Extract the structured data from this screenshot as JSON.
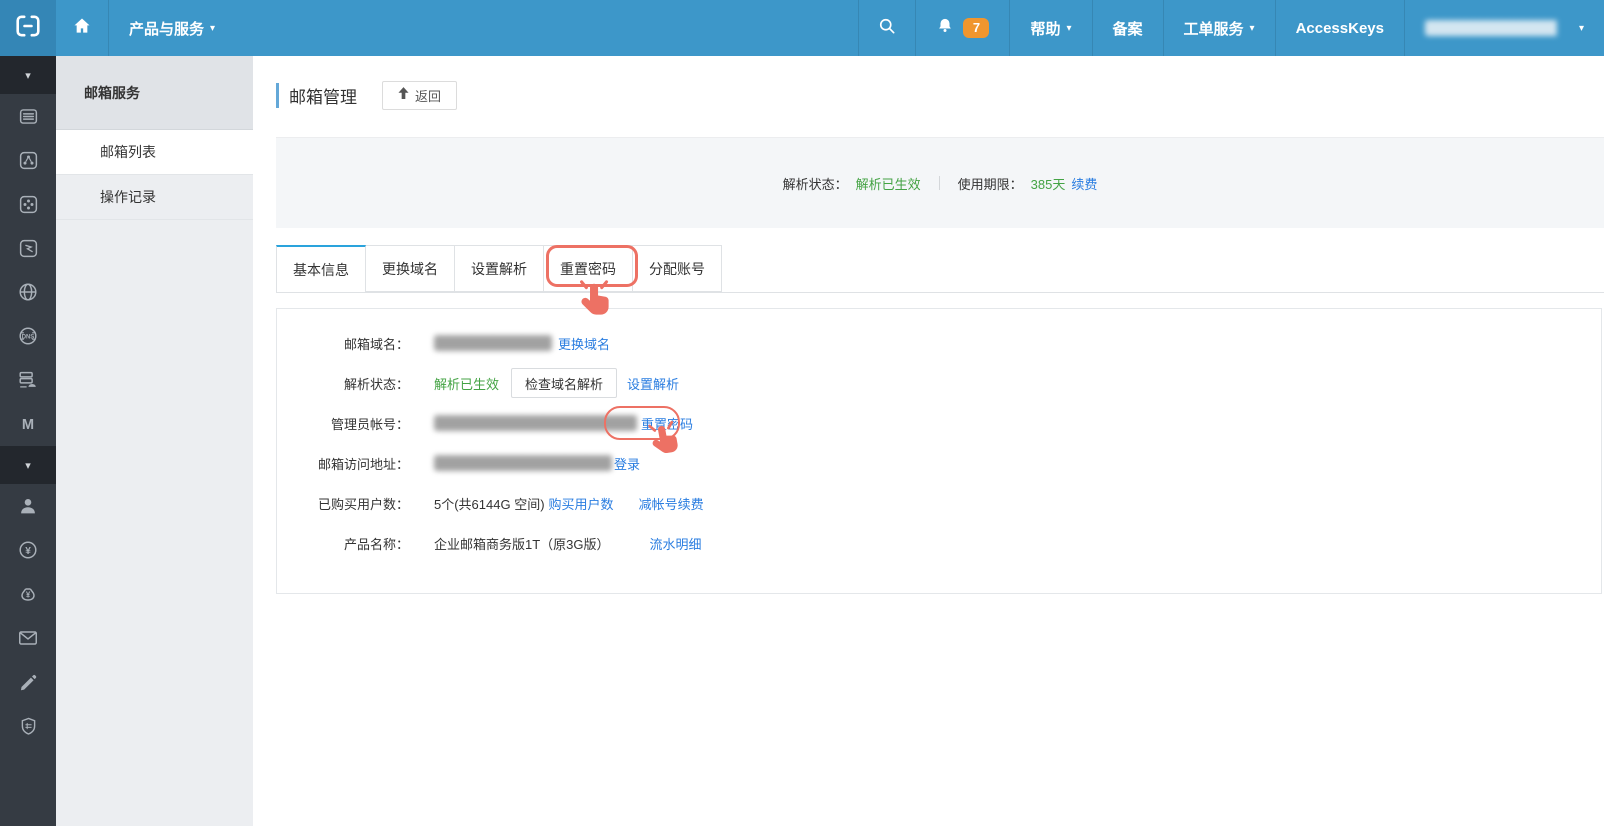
{
  "topbar": {
    "products_label": "产品与服务",
    "notification_count": "7",
    "help_label": "帮助",
    "beian_label": "备案",
    "tickets_label": "工单服务",
    "accesskeys_label": "AccessKeys",
    "account_masked": "██████████████████"
  },
  "icons": {
    "caret": "▾",
    "dns_label": "DNS",
    "mq_letter": "M",
    "yen": "¥"
  },
  "sidebar": {
    "icon_names": [
      "collapse-chevron",
      "instance-list-icon",
      "slb-icon",
      "oss-icon",
      "cdn-icon",
      "network-globe-icon",
      "dns-icon",
      "storage-icon",
      "mq-icon",
      "collapse-chevron-2",
      "user-icon",
      "billing-yen-icon",
      "fund-moneybag-icon",
      "mail-icon",
      "edit-pencil-icon",
      "security-shield-icon"
    ]
  },
  "subsidebar": {
    "title": "邮箱服务",
    "items": [
      "邮箱列表",
      "操作记录"
    ],
    "active_item": "邮箱列表"
  },
  "page": {
    "title": "邮箱管理",
    "back_label": "返回"
  },
  "statusbar": {
    "resolve_label": "解析状态：",
    "resolve_value": "解析已生效",
    "period_label": "使用期限：",
    "period_value": "385天",
    "renew_link": "续费"
  },
  "tabs": {
    "items": [
      "基本信息",
      "更换域名",
      "设置解析",
      "重置密码",
      "分配账号"
    ],
    "active": "基本信息"
  },
  "details": {
    "domain_label": "邮箱域名：",
    "domain_masked": "██████████████████",
    "change_domain_link": "更换域名",
    "resolve_label": "解析状态：",
    "resolve_status": "解析已生效",
    "check_resolve_button": "检查域名解析",
    "set_resolve_link": "设置解析",
    "admin_label": "管理员帐号：",
    "admin_masked": "█████████████████████████████",
    "reset_password_link": "重置密码",
    "webmail_label": "邮箱访问地址：",
    "webmail_masked": "██████████████████████████",
    "login_link": "登录",
    "users_label": "已购买用户数：",
    "users_value": "5个(共6144G 空间)",
    "buy_users_link": "购买用户数",
    "reduce_renew_link": "减帐号续费",
    "product_label": "产品名称：",
    "product_value": "企业邮箱商务版1T（原3G版）",
    "billing_link": "流水明细"
  },
  "colors": {
    "topbar_blue": "#3d97c9",
    "logo_tile_blue": "#3486b6",
    "active_tab_blue": "#2aa3dc",
    "link_blue": "#2a7de0",
    "success_green": "#44a344",
    "annotation_red": "#ed7164",
    "badge_orange": "#f0962e",
    "sidebar_dark": "#353b43"
  }
}
